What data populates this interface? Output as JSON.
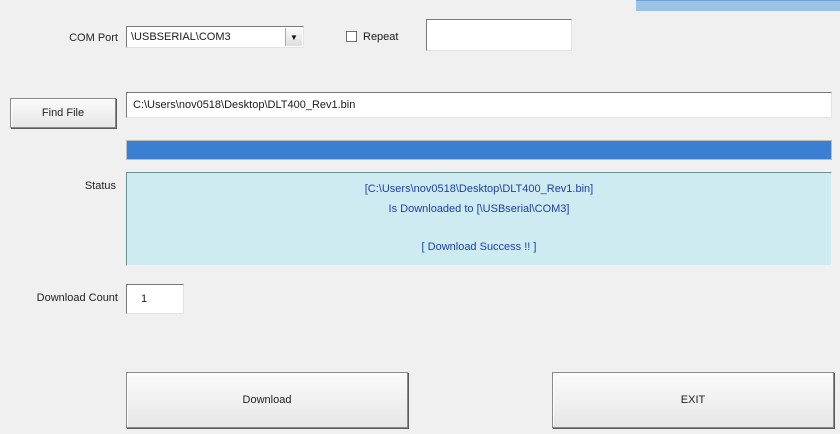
{
  "com_port": {
    "label": "COM Port",
    "value": "\\USBSERIAL\\COM3",
    "dropdown_icon": "chevron-down-icon"
  },
  "repeat": {
    "label": "Repeat",
    "checked": false,
    "value": ""
  },
  "find_file": {
    "button_label": "Find File",
    "path": "C:\\Users\\nov0518\\Desktop\\DLT400_Rev1.bin"
  },
  "progress": {
    "fraction": 1.0,
    "fill_color": "#3a7fd1"
  },
  "status": {
    "label": "Status",
    "line1": "[C:\\Users\\nov0518\\Desktop\\DLT400_Rev1.bin]",
    "line2": "Is Downloaded to [\\USBserial\\COM3]",
    "line3": "[ Download Success !! ]",
    "text_color": "#1f3fa8",
    "background_color": "#cdebf0"
  },
  "download_count": {
    "label": "Download Count",
    "value": "1"
  },
  "buttons": {
    "download": "Download",
    "exit": "EXIT"
  }
}
